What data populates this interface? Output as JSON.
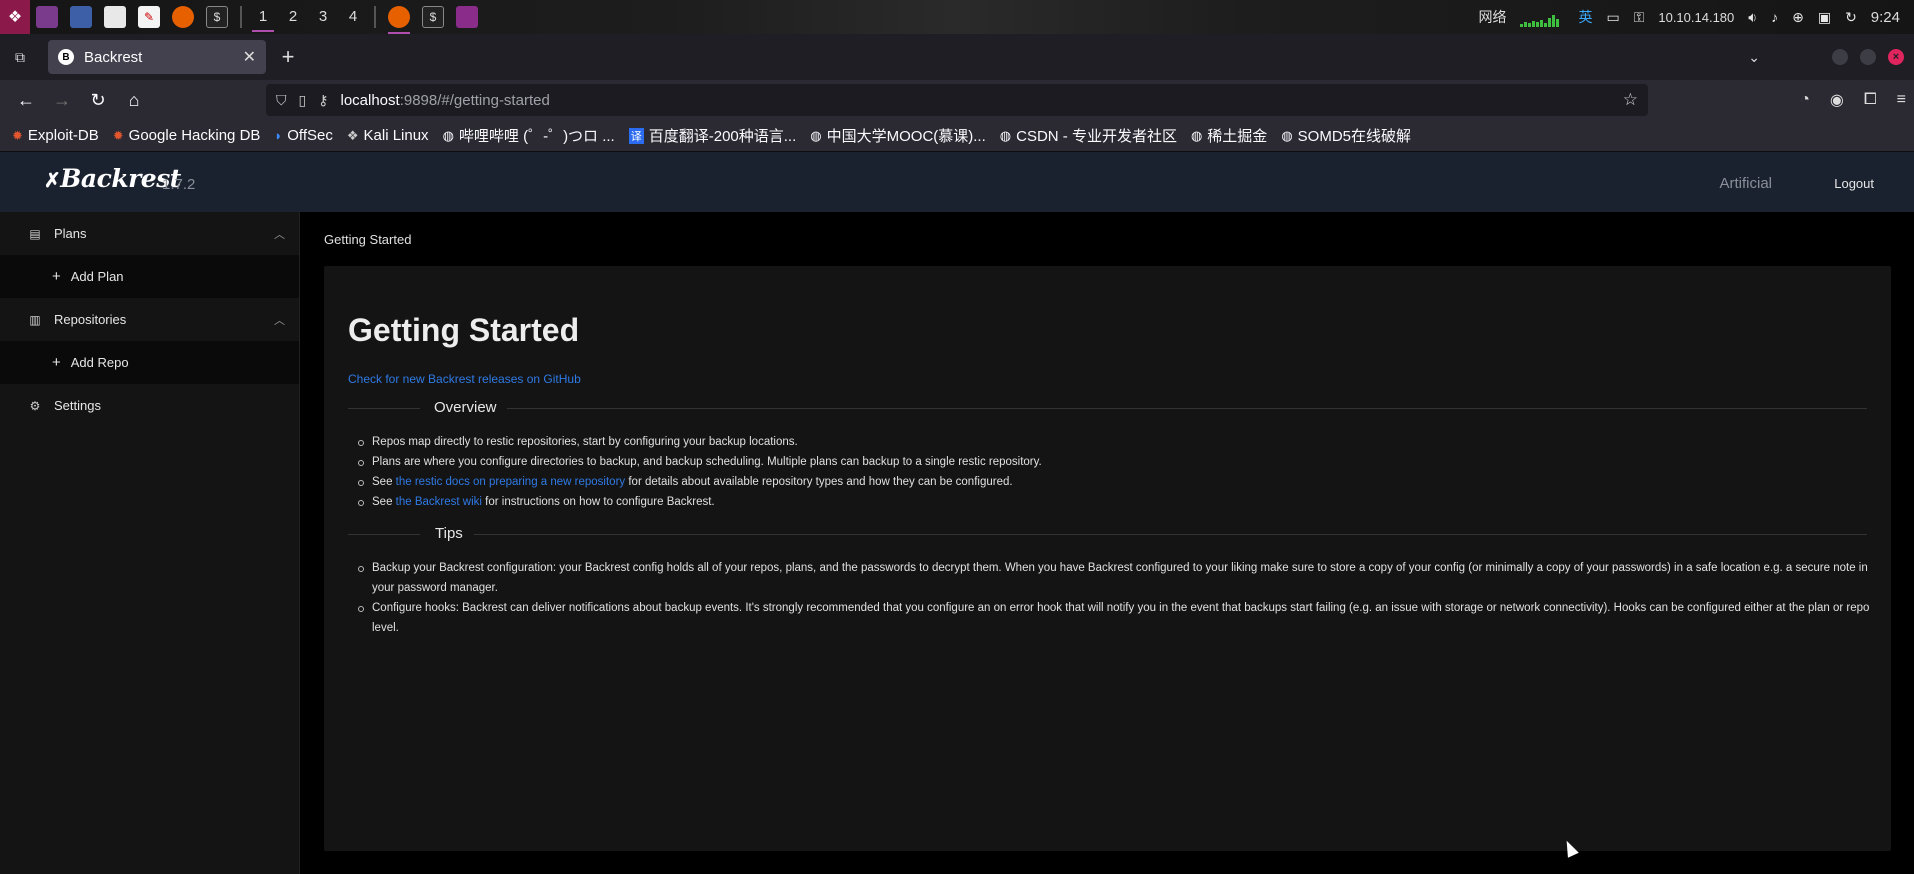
{
  "os_taskbar": {
    "workspaces": [
      "1",
      "2",
      "3",
      "4"
    ],
    "active_workspace": "1",
    "network_label": "网络",
    "input_method": "英",
    "ip_address": "10.10.14.180",
    "clock": "9:24"
  },
  "browser": {
    "tab_title": "Backrest",
    "url_host": "localhost",
    "url_rest": ":9898/#/getting-started",
    "bookmarks": [
      "Exploit-DB",
      "Google Hacking DB",
      "OffSec",
      "Kali Linux",
      "哔哩哔哩 (゜-゜)つロ ...",
      "百度翻译-200种语言...",
      "中国大学MOOC(慕课)...",
      "CSDN - 专业开发者社区",
      "稀土掘金",
      "SOMD5在线破解"
    ]
  },
  "app": {
    "logo": "Backrest",
    "version": "1.7.2",
    "instance": "Artificial",
    "logout": "Logout"
  },
  "sidebar": {
    "plans": "Plans",
    "add_plan": "Add Plan",
    "repositories": "Repositories",
    "add_repo": "Add Repo",
    "settings": "Settings"
  },
  "main": {
    "breadcrumb": "Getting Started",
    "title": "Getting Started",
    "github_link": "Check for new Backrest releases on GitHub",
    "overview_heading": "Overview",
    "overview": {
      "item1": "Repos map directly to restic repositories, start by configuring your backup locations.",
      "item2": "Plans are where you configure directories to backup, and backup scheduling. Multiple plans can backup to a single restic repository.",
      "item3_prefix": "See ",
      "item3_link": "the restic docs on preparing a new repository",
      "item3_suffix": " for details about available repository types and how they can be configured.",
      "item4_prefix": "See ",
      "item4_link": "the Backrest wiki",
      "item4_suffix": " for instructions on how to configure Backrest."
    },
    "tips_heading": "Tips",
    "tips": {
      "item1": "Backup your Backrest configuration: your Backrest config holds all of your repos, plans, and the passwords to decrypt them. When you have Backrest configured to your liking make sure to store a copy of your config (or minimally a copy of your passwords) in a safe location e.g. a secure note in your password manager.",
      "item2": "Configure hooks: Backrest can deliver notifications about backup events. It's strongly recommended that you configure an on error hook that will notify you in the event that backups start failing (e.g. an issue with storage or network connectivity). Hooks can be configured either at the plan or repo level."
    }
  },
  "colors": {
    "link": "#2f7ae5",
    "header_bg": "#1a2230",
    "card_bg": "#141414"
  }
}
